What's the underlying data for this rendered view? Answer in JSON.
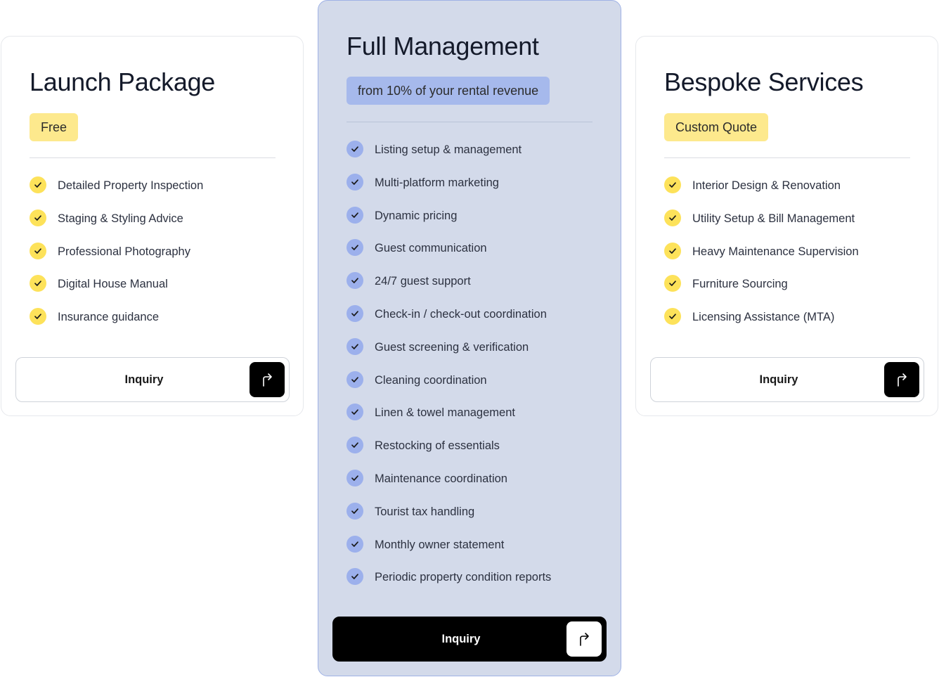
{
  "colors": {
    "accent_yellow": "#fde25a",
    "badge_yellow": "#fde98d",
    "accent_blue": "#9cb0ec",
    "highlight_card_bg": "#d3daea",
    "button_dark": "#000000"
  },
  "cards": [
    {
      "title": "Launch Package",
      "badge": "Free",
      "check_icon": "check-icon",
      "features": [
        "Detailed Property Inspection",
        "Staging & Styling Advice",
        "Professional Photography",
        "Digital House Manual",
        "Insurance guidance"
      ],
      "button_label": "Inquiry",
      "button_icon": "arrow-turn-up-right-icon"
    },
    {
      "title": "Full Management",
      "badge": "from 10% of your rental revenue",
      "check_icon": "check-icon",
      "features": [
        "Listing setup & management",
        "Multi-platform marketing",
        "Dynamic pricing",
        "Guest communication",
        "24/7 guest support",
        "Check-in / check-out coordination",
        "Guest screening & verification",
        "Cleaning coordination",
        "Linen & towel management",
        "Restocking of essentials",
        "Maintenance coordination",
        "Tourist tax handling",
        "Monthly owner statement",
        "Periodic property condition reports"
      ],
      "button_label": "Inquiry",
      "button_icon": "arrow-turn-up-right-icon"
    },
    {
      "title": "Bespoke Services",
      "badge": "Custom Quote",
      "check_icon": "check-icon",
      "features": [
        "Interior Design & Renovation",
        "Utility Setup & Bill Management",
        "Heavy Maintenance Supervision",
        "Furniture Sourcing",
        "Licensing Assistance (MTA)"
      ],
      "button_label": "Inquiry",
      "button_icon": "arrow-turn-up-right-icon"
    }
  ]
}
